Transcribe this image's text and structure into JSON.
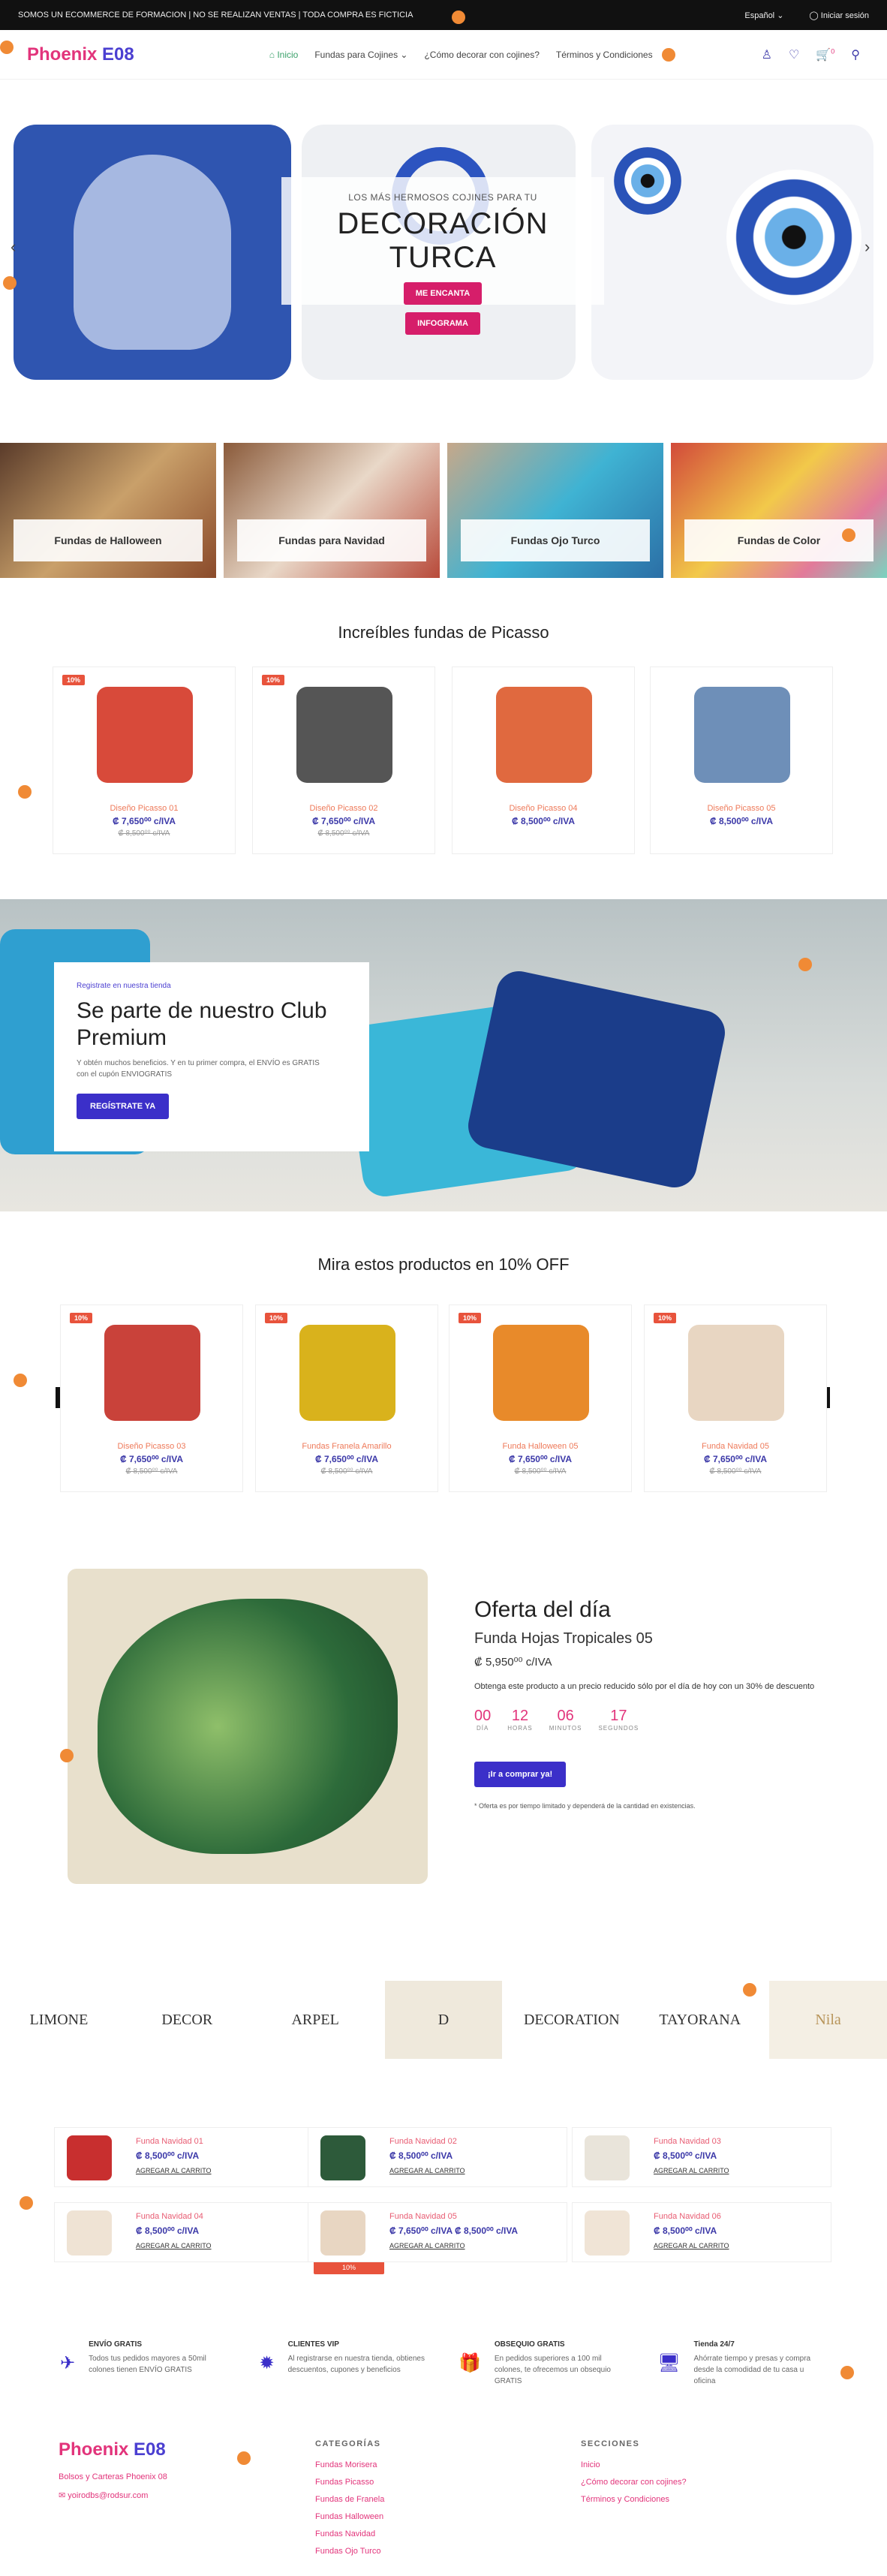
{
  "topbar": {
    "notice": "SOMOS UN ECOMMERCE DE FORMACION | NO SE REALIZAN VENTAS | TODA COMPRA ES FICTICIA",
    "language": "Español",
    "login": "Iniciar sesión"
  },
  "header": {
    "logo_main": "Phoenix ",
    "logo_accent": "E08",
    "nav": [
      "Inicio",
      "Fundas para Cojines",
      "¿Cómo decorar con cojines?",
      "Términos y Condiciones"
    ],
    "cart_count": "0"
  },
  "hero": {
    "subtitle": "LOS MÁS HERMOSOS COJINES PARA TU",
    "title": "DECORACIÓN TURCA",
    "btn1": "ME ENCANTA",
    "btn2": "INFOGRAMA"
  },
  "categories": [
    "Fundas de Halloween",
    "Fundas para Navidad",
    "Fundas Ojo Turco",
    "Fundas de Color"
  ],
  "picasso": {
    "title": "Increíbles fundas de Picasso",
    "products": [
      {
        "badge": "10%",
        "name": "Diseño Picasso 01",
        "price": "₡ 7,650⁰⁰ c/IVA",
        "old": "₡ 8,500⁰⁰ c/IVA",
        "color": "#d84a3a"
      },
      {
        "badge": "10%",
        "name": "Diseño Picasso 02",
        "price": "₡ 7,650⁰⁰ c/IVA",
        "old": "₡ 8,500⁰⁰ c/IVA",
        "color": "#555555"
      },
      {
        "badge": "",
        "name": "Diseño Picasso 04",
        "price": "₡ 8,500⁰⁰ c/IVA",
        "old": "",
        "color": "#e0693f"
      },
      {
        "badge": "",
        "name": "Diseño Picasso 05",
        "price": "₡ 8,500⁰⁰ c/IVA",
        "old": "",
        "color": "#6e8fb8"
      }
    ]
  },
  "club": {
    "kicker": "Registrate en nuestra tienda",
    "title": "Se parte de nuestro Club Premium",
    "text": "Y obtén muchos beneficios. Y en tu primer compra, el ENVÍO es GRATIS con el cupón ENVIOGRATIS",
    "button": "REGÍSTRATE YA"
  },
  "off": {
    "title": "Mira estos productos en 10% OFF",
    "products": [
      {
        "badge": "10%",
        "name": "Diseño Picasso 03",
        "price": "₡ 7,650⁰⁰ c/IVA",
        "old": "₡ 8,500⁰⁰ c/IVA",
        "color": "#c9423a"
      },
      {
        "badge": "10%",
        "name": "Fundas Franela Amarillo",
        "price": "₡ 7,650⁰⁰ c/IVA",
        "old": "₡ 8,500⁰⁰ c/IVA",
        "color": "#d9b21c"
      },
      {
        "badge": "10%",
        "name": "Funda Halloween 05",
        "price": "₡ 7,650⁰⁰ c/IVA",
        "old": "₡ 8,500⁰⁰ c/IVA",
        "color": "#e88a2a"
      },
      {
        "badge": "10%",
        "name": "Funda Navidad 05",
        "price": "₡ 7,650⁰⁰ c/IVA",
        "old": "₡ 8,500⁰⁰ c/IVA",
        "color": "#e8d6c2"
      }
    ]
  },
  "deal": {
    "heading": "Oferta del día",
    "product": "Funda Hojas Tropicales 05",
    "price": "₡ 5,950⁰⁰ c/IVA",
    "desc": "Obtenga este producto a un precio reducido sólo por el día de hoy con un 30% de descuento",
    "timer": [
      {
        "n": "00",
        "l": "DÍA"
      },
      {
        "n": "12",
        "l": "HORAS"
      },
      {
        "n": "06",
        "l": "MINUTOS"
      },
      {
        "n": "17",
        "l": "SEGUNDOS"
      }
    ],
    "button": "¡Ir a comprar ya!",
    "note": "* Oferta es por tiempo limitado y dependerá de la cantidad en existencias."
  },
  "brands": [
    "LIMONE",
    "DECOR",
    "ARPEL",
    "D",
    "DECORATION",
    "TAYORANA",
    "Nila"
  ],
  "mini_products": [
    {
      "name": "Funda Navidad 01",
      "price": "₡ 8,500⁰⁰ c/IVA",
      "action": "AGREGAR AL CARRITO",
      "color": "#c82f2f"
    },
    {
      "name": "Funda Navidad 02",
      "price": "₡ 8,500⁰⁰ c/IVA",
      "action": "AGREGAR AL CARRITO",
      "color": "#2d5a3a"
    },
    {
      "name": "Funda Navidad 03",
      "price": "₡ 8,500⁰⁰ c/IVA",
      "action": "AGREGAR AL CARRITO",
      "color": "#e9e4da"
    },
    {
      "name": "Funda Navidad 04",
      "price": "₡ 8,500⁰⁰ c/IVA",
      "action": "AGREGAR AL CARRITO",
      "color": "#efe3d4"
    },
    {
      "name": "Funda Navidad 05",
      "price": "₡ 7,650⁰⁰ c/IVA ₡ 8,500⁰⁰ c/IVA",
      "action": "AGREGAR AL CARRITO",
      "color": "#e8d6c2"
    },
    {
      "name": "Funda Navidad 06",
      "price": "₡ 8,500⁰⁰ c/IVA",
      "action": "AGREGAR AL CARRITO",
      "color": "#f0e4d6"
    }
  ],
  "mini_badge": "10%",
  "features": [
    {
      "icon": "✈",
      "title": "ENVÍO GRATIS",
      "desc": "Todos tus pedidos mayores a 50mil colones tienen ENVÍO GRATIS"
    },
    {
      "icon": "✹",
      "title": "CLIENTES VIP",
      "desc": "Al registrarse en nuestra tienda, obtienes descuentos, cupones y beneficios"
    },
    {
      "icon": "🎁",
      "title": "OBSEQUIO GRATIS",
      "desc": "En pedidos superiores a 100 mil colones, te ofrecemos un obsequio GRATIS"
    },
    {
      "icon": "🖥",
      "title": "Tienda 24/7",
      "desc": "Ahórrate tiempo y presas y compra desde la comodidad de tu casa u oficina"
    }
  ],
  "footer": {
    "about": "Bolsos y Carteras Phoenix 08",
    "email": "yoirodbs@rodsur.com",
    "categories_title": "CATEGORÍAS",
    "categories": [
      "Fundas Morisera",
      "Fundas Picasso",
      "Fundas de Franela",
      "Fundas Halloween",
      "Fundas Navidad",
      "Fundas Ojo Turco"
    ],
    "sections_title": "SECCIONES",
    "sections": [
      "Inicio",
      "¿Cómo decorar con cojines?",
      "Términos y Condiciones"
    ]
  }
}
